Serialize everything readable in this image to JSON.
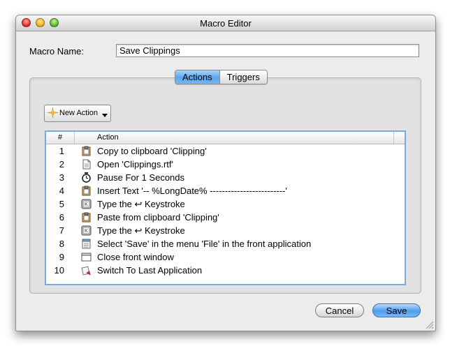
{
  "window": {
    "title": "Macro Editor"
  },
  "macro": {
    "name_label": "Macro Name:",
    "name_value": "Save Clippings"
  },
  "tabs": [
    {
      "label": "Actions",
      "active": true
    },
    {
      "label": "Triggers",
      "active": false
    }
  ],
  "new_action": {
    "label": "New Action"
  },
  "table": {
    "columns": [
      "#",
      "Action"
    ],
    "rows": [
      {
        "num": "1",
        "icon": "clipboard-icon",
        "text": "Copy to clipboard 'Clipping'"
      },
      {
        "num": "2",
        "icon": "document-icon",
        "text": "Open 'Clippings.rtf'"
      },
      {
        "num": "3",
        "icon": "stopwatch-icon",
        "text": "Pause For 1 Seconds"
      },
      {
        "num": "4",
        "icon": "clipboard-icon",
        "text": "Insert Text '-- %LongDate% -------------------------'"
      },
      {
        "num": "5",
        "icon": "keystroke-icon",
        "text": "Type the ↩ Keystroke"
      },
      {
        "num": "6",
        "icon": "clipboard-icon",
        "text": "Paste from clipboard 'Clipping'"
      },
      {
        "num": "7",
        "icon": "keystroke-icon",
        "text": "Type the ↩ Keystroke"
      },
      {
        "num": "8",
        "icon": "menu-icon",
        "text": "Select 'Save' in the menu 'File' in the front application"
      },
      {
        "num": "9",
        "icon": "window-icon",
        "text": "Close front window"
      },
      {
        "num": "10",
        "icon": "switch-app-icon",
        "text": "Switch To Last Application"
      }
    ]
  },
  "buttons": {
    "cancel": "Cancel",
    "save": "Save"
  },
  "colors": {
    "accent": "#5ba6ef",
    "table_focus": "#7aa9e0"
  }
}
